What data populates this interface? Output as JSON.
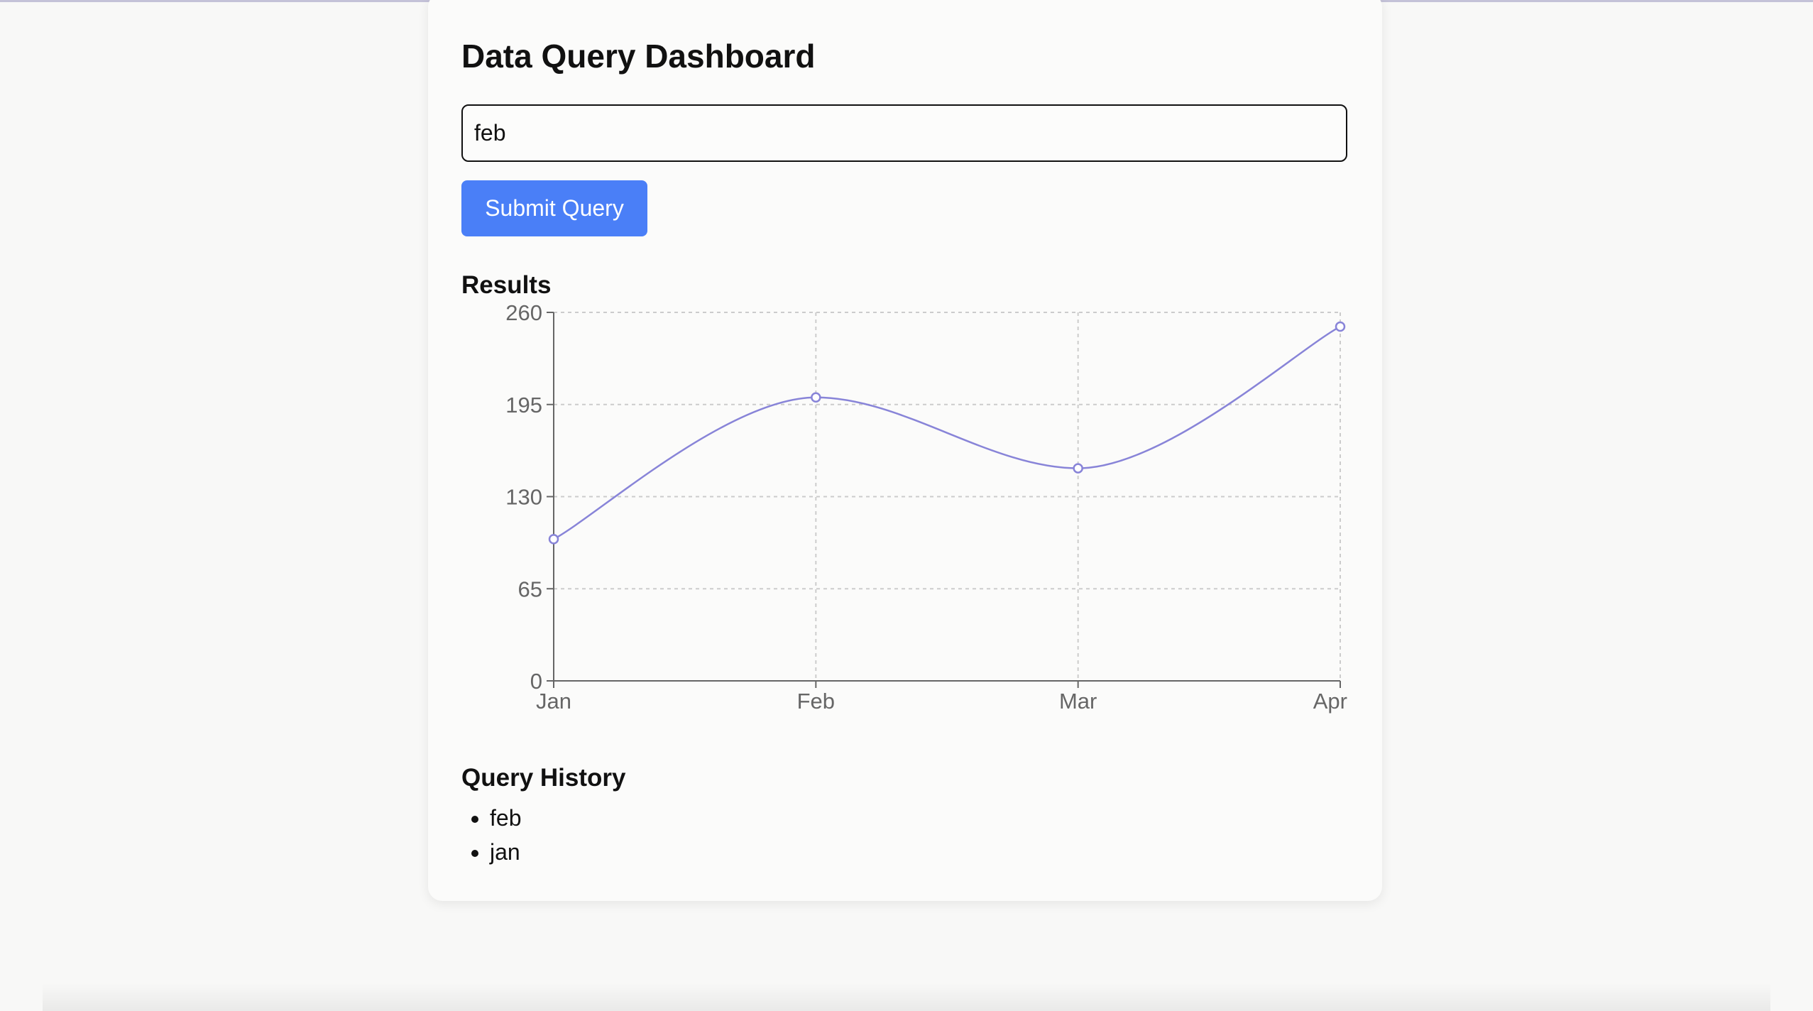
{
  "header": {
    "title": "Data Query Dashboard"
  },
  "query": {
    "value": "feb",
    "submit_label": "Submit Query"
  },
  "results": {
    "heading": "Results"
  },
  "chart_data": {
    "type": "line",
    "categories": [
      "Jan",
      "Feb",
      "Mar",
      "Apr"
    ],
    "values": [
      100,
      200,
      150,
      250
    ],
    "yticks": [
      "0",
      "65",
      "130",
      "195",
      "260"
    ],
    "ylim": [
      0,
      260
    ],
    "grid": true,
    "line_color": "#8884d8",
    "title": "",
    "xlabel": "",
    "ylabel": ""
  },
  "history": {
    "heading": "Query History",
    "items": [
      "feb",
      "jan"
    ]
  },
  "colors": {
    "accent": "#4a7ff7"
  }
}
